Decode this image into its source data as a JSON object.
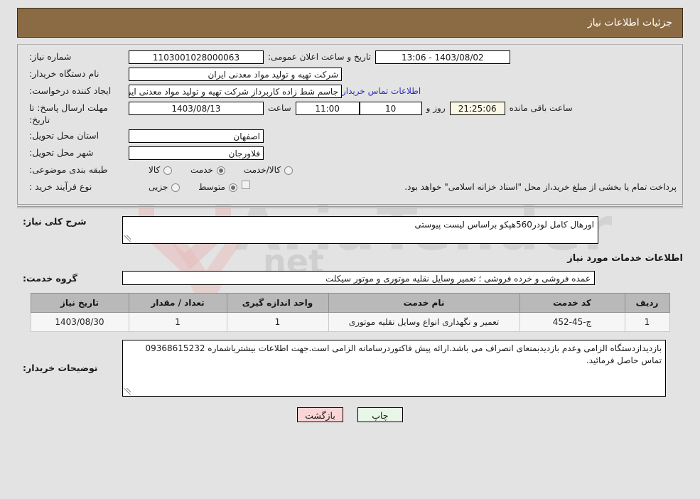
{
  "header": {
    "title": "جزئیات اطلاعات نیاز",
    "bar_color": "#8b6b43"
  },
  "info": {
    "need_number_label": "شماره نیاز:",
    "need_number_value": "1103001028000063",
    "public_announce_label": "تاریخ و ساعت اعلان عمومی:",
    "public_announce_value": "13:06 - 1403/08/02",
    "buyer_org_label": "نام دستگاه خریدار:",
    "buyer_org_value": "شرکت تهیه و تولید مواد معدنی ایران",
    "creator_label": "ایجاد کننده درخواست:",
    "creator_value": "جاسم شط زاده کاربرداز شرکت تهیه و تولید مواد معدنی ایران",
    "contact_link": "اطلاعات تماس خریدار",
    "deadline_label": "مهلت ارسال پاسخ: تا تاریخ:",
    "deadline_date": "1403/08/13",
    "hour_label": "ساعت",
    "deadline_time": "11:00",
    "days_value": "10",
    "days_label": "روز و",
    "countdown_value": "21:25:06",
    "remaining_label": "ساعت باقی مانده",
    "province_label": "استان محل تحویل:",
    "province_value": "اصفهان",
    "city_label": "شهر محل تحویل:",
    "city_value": "فلاورجان",
    "category_label": "طبقه بندی موضوعی:",
    "category_options": [
      {
        "label": "کالا",
        "selected": false
      },
      {
        "label": "خدمت",
        "selected": true
      },
      {
        "label": "کالا/خدمت",
        "selected": false
      }
    ],
    "process_label": "نوع فرآیند خرید :",
    "process_options": [
      {
        "label": "جزیی",
        "selected": false
      },
      {
        "label": "متوسط",
        "selected": true
      }
    ],
    "treasury_checkbox_checked": false,
    "treasury_note": "پرداخت تمام یا بخشی از مبلغ خرید،از محل \"اسناد خزانه اسلامی\" خواهد بود."
  },
  "description": {
    "label": "شرح کلی نیاز:",
    "value": "اورهال کامل لودر560هپکو براساس لیست پیوستی"
  },
  "services_section": {
    "heading": "اطلاعات خدمات مورد نیاز",
    "group_label": "گروه خدمت:",
    "group_value": "عمده فروشی و خرده فروشی ؛ تعمیر وسایل نقلیه موتوری و موتور سیکلت"
  },
  "table": {
    "columns": [
      "ردیف",
      "کد خدمت",
      "نام خدمت",
      "واحد اندازه گیری",
      "تعداد / مقدار",
      "تاریخ نیاز"
    ],
    "rows": [
      {
        "index": "1",
        "code": "ج-45-452",
        "name": "تعمیر و نگهداری انواع وسایل نقلیه موتوری",
        "unit": "1",
        "quantity": "1",
        "need_date": "1403/08/30"
      }
    ]
  },
  "notes": {
    "label": "توضیحات خریدار:",
    "value": "بازدیدازدستگاه الزامی وعدم بازدیدبمنعای انصراف می باشد.ارائه پیش فاکتوردرسامانه الزامی است.جهت اطلاعات بیشترباشماره 09368615232 تماس حاصل فرمائید."
  },
  "buttons": {
    "print": "چاپ",
    "back": "بازگشت"
  },
  "watermark": {
    "brand_text": "AriaTender",
    "top_text": "net"
  }
}
